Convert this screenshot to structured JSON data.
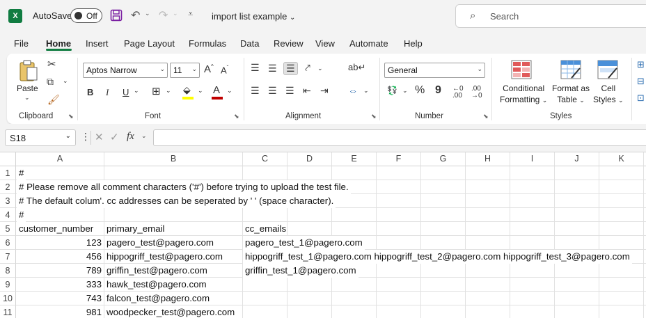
{
  "titlebar": {
    "autosave_label": "AutoSave",
    "autosave_state": "Off",
    "document_title": "import list example",
    "search_placeholder": "Search"
  },
  "menu": {
    "tabs": [
      "File",
      "Home",
      "Insert",
      "Page Layout",
      "Formulas",
      "Data",
      "Review",
      "View",
      "Automate",
      "Help"
    ],
    "active": "Home"
  },
  "ribbon": {
    "clipboard": {
      "paste": "Paste",
      "label": "Clipboard"
    },
    "font": {
      "name": "Aptos Narrow",
      "size": "11",
      "label": "Font",
      "grow": "A",
      "shrink": "A",
      "bold": "B",
      "italic": "I",
      "underline": "U"
    },
    "alignment": {
      "label": "Alignment"
    },
    "number": {
      "format": "General",
      "label": "Number",
      "percent": "%",
      "comma": "9"
    },
    "styles": {
      "label": "Styles",
      "conditional_formatting_line1": "Conditional",
      "conditional_formatting_line2": "Formatting",
      "format_as_table_line1": "Format as",
      "format_as_table_line2": "Table",
      "cell_styles_line1": "Cell",
      "cell_styles_line2": "Styles"
    }
  },
  "formula_bar": {
    "name_box": "S18",
    "fx": "fx",
    "value": ""
  },
  "sheet": {
    "columns": [
      "A",
      "B",
      "C",
      "D",
      "E",
      "F",
      "G",
      "H",
      "I",
      "J",
      "K"
    ],
    "rows": [
      "1",
      "2",
      "3",
      "4",
      "5",
      "6",
      "7",
      "8",
      "9",
      "10",
      "11"
    ],
    "cells": {
      "r1": "#",
      "r2": "# Please remove all comment characters ('#') before trying to upload the test file.",
      "r3": "# The default colum'. cc addresses can be seperated by ' ' (space character).",
      "r4": "#",
      "header_a": "customer_number",
      "header_b": "primary_email",
      "header_c": "cc_emails",
      "data": [
        {
          "a": "123",
          "b": "pagero_test@pagero.com",
          "c": "pagero_test_1@pagero.com"
        },
        {
          "a": "456",
          "b": "hippogriff_test@pagero.com",
          "c": "hippogriff_test_1@pagero.com hippogriff_test_2@pagero.com hippogriff_test_3@pagero.com"
        },
        {
          "a": "789",
          "b": "griffin_test@pagero.com",
          "c": "griffin_test_1@pagero.com"
        },
        {
          "a": "333",
          "b": "hawk_test@pagero.com",
          "c": ""
        },
        {
          "a": "743",
          "b": "falcon_test@pagero.com",
          "c": ""
        },
        {
          "a": "981",
          "b": "woodpecker_test@pagero.com",
          "c": ""
        }
      ]
    }
  },
  "colors": {
    "excel_green": "#107c41",
    "font_color_red": "#c00000",
    "highlight_yellow": "#ffff00"
  }
}
